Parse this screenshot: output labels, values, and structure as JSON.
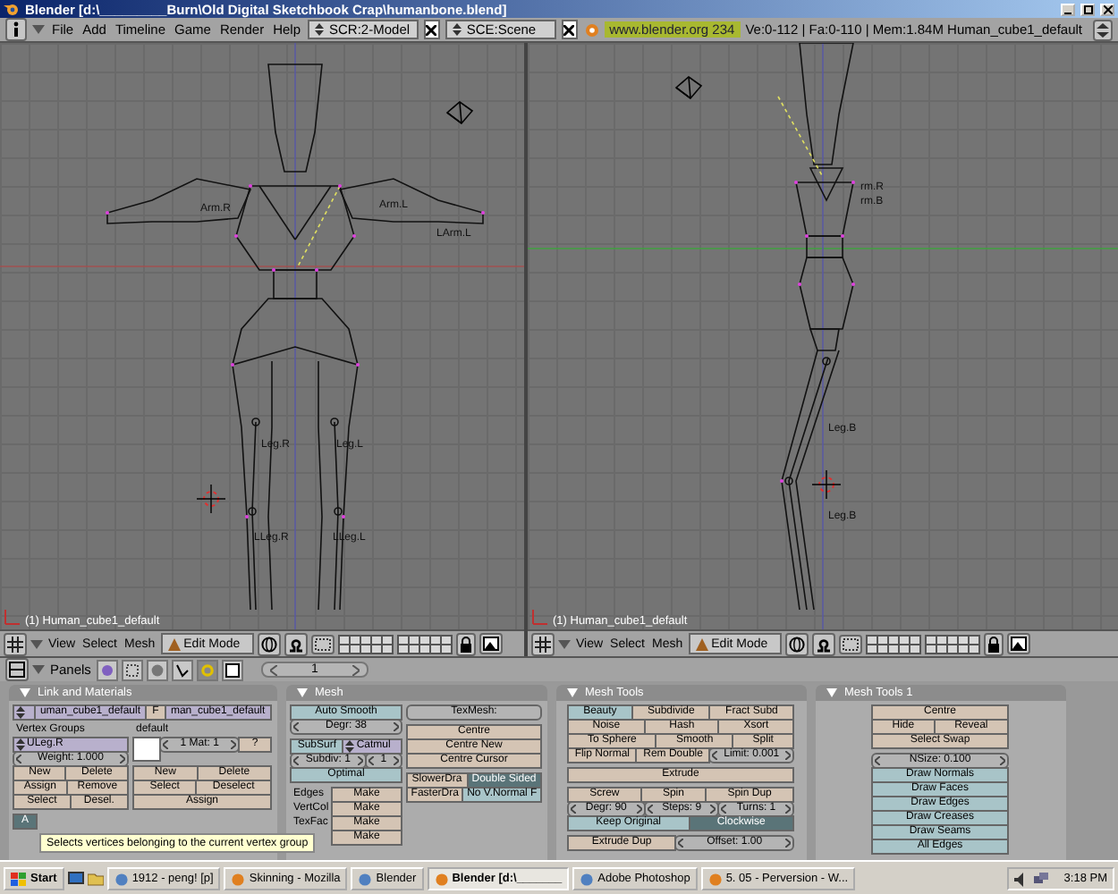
{
  "title_bar": {
    "title": "Blender [d:\\_________Burn\\Old Digital Sketchbook Crap\\humanbone.blend]"
  },
  "menu_bar": {
    "menus": [
      "File",
      "Add",
      "Timeline",
      "Game",
      "Render",
      "Help"
    ],
    "screen": "SCR:2-Model",
    "scene": "SCE:Scene",
    "website": "www.blender.org 234",
    "stats": "Ve:0-112 | Fa:0-110 | Mem:1.84M Human_cube1_default"
  },
  "viewports": [
    {
      "kind": "front",
      "bone_labels": [
        "Arm.R",
        "Arm.L",
        "LArm.L",
        "Leg.R",
        "Leg.L",
        "LLeg.R",
        "LLeg.L"
      ],
      "object_label": "(1) Human_cube1_default",
      "header": {
        "menus": [
          "View",
          "Select",
          "Mesh"
        ],
        "mode": "Edit Mode"
      }
    },
    {
      "kind": "side",
      "bone_labels": [
        "rm.R",
        "rm.B",
        "Leg.B",
        "Leg.B"
      ],
      "object_label": "(1) Human_cube1_default",
      "header": {
        "menus": [
          "View",
          "Select",
          "Mesh"
        ],
        "mode": "Edit Mode"
      }
    }
  ],
  "buttons_header": {
    "label": "Panels",
    "frame": "1"
  },
  "panels": [
    {
      "title": "Link and Materials",
      "top": [
        [
          {
            "kind": "menu"
          },
          {
            "kind": "text",
            "label": "uman_cube1_default"
          },
          {
            "kind": "button",
            "label": "F"
          },
          {
            "kind": "text",
            "label": "man_cube1_default"
          }
        ]
      ],
      "columns": [
        {
          "groups": [
            [
              [
                {
                  "kind": "label",
                  "label": "Vertex Groups"
                }
              ],
              [
                {
                  "kind": "menu",
                  "label": "ULeg.R"
                }
              ],
              [
                {
                  "kind": "number",
                  "label": "Weight: 1.000"
                }
              ],
              [
                {
                  "kind": "button",
                  "label": "New"
                },
                {
                  "kind": "button",
                  "label": "Delete"
                }
              ],
              [
                {
                  "kind": "button",
                  "label": "Assign"
                },
                {
                  "kind": "button",
                  "label": "Remove"
                }
              ],
              [
                {
                  "kind": "button",
                  "label": "Select"
                },
                {
                  "kind": "button",
                  "label": "Desel."
                }
              ]
            ],
            [
              [
                {
                  "kind": "toggle",
                  "label": "A",
                  "on": true
                }
              ]
            ]
          ]
        },
        {
          "groups": [
            [
              [
                {
                  "kind": "label",
                  "label": "default"
                }
              ],
              [
                {
                  "kind": "swatch"
                },
                {
                  "kind": "number",
                  "label": "1 Mat: 1"
                },
                {
                  "kind": "button",
                  "label": "?"
                }
              ]
            ],
            [
              [
                {
                  "kind": "button",
                  "label": "New"
                },
                {
                  "kind": "button",
                  "label": "Delete"
                }
              ],
              [
                {
                  "kind": "button",
                  "label": "Select"
                },
                {
                  "kind": "button",
                  "label": "Deselect"
                }
              ],
              [
                {
                  "kind": "button",
                  "label": "Assign"
                }
              ]
            ]
          ]
        }
      ]
    },
    {
      "title": "Mesh",
      "columns": [
        {
          "groups": [
            [
              [
                {
                  "kind": "toggle",
                  "label": "Auto Smooth",
                  "on": false
                }
              ],
              [
                {
                  "kind": "number",
                  "label": "Degr: 38"
                }
              ]
            ],
            [
              [
                {
                  "kind": "toggle",
                  "label": "SubSurf",
                  "on": false
                },
                {
                  "kind": "menu",
                  "label": "Catmul"
                }
              ],
              [
                {
                  "kind": "number",
                  "label": "Subdiv: 1"
                },
                {
                  "kind": "number",
                  "label": "1"
                }
              ],
              [
                {
                  "kind": "toggle",
                  "label": "Optimal",
                  "on": false
                }
              ]
            ],
            [
              [
                {
                  "kind": "label",
                  "label": "Edges"
                },
                {
                  "kind": "button",
                  "label": "Make"
                }
              ],
              [
                {
                  "kind": "label",
                  "label": "VertCol"
                },
                {
                  "kind": "button",
                  "label": "Make"
                }
              ],
              [
                {
                  "kind": "label",
                  "label": "TexFac"
                },
                {
                  "kind": "button",
                  "label": "Make"
                }
              ],
              [
                {
                  "kind": "label"
                },
                {
                  "kind": "button",
                  "label": "Make"
                }
              ]
            ]
          ]
        },
        {
          "groups": [
            [
              [
                {
                  "kind": "text",
                  "label": "TexMesh:"
                }
              ]
            ],
            [
              [
                {
                  "kind": "button",
                  "label": "Centre"
                }
              ],
              [
                {
                  "kind": "button",
                  "label": "Centre New"
                }
              ],
              [
                {
                  "kind": "button",
                  "label": "Centre Cursor"
                }
              ]
            ],
            [
              [
                {
                  "kind": "button",
                  "label": "SlowerDra"
                },
                {
                  "kind": "toggle",
                  "label": "Double Sided",
                  "on": true
                }
              ],
              [
                {
                  "kind": "button",
                  "label": "FasterDra"
                },
                {
                  "kind": "toggle",
                  "label": "No V.Normal F",
                  "on": false
                }
              ]
            ]
          ]
        }
      ]
    },
    {
      "title": "Mesh Tools",
      "columns": [
        {
          "groups": [
            [
              [
                {
                  "kind": "toggle",
                  "label": "Beauty",
                  "on": false
                },
                {
                  "kind": "button",
                  "label": "Subdivide"
                },
                {
                  "kind": "button",
                  "label": "Fract Subd"
                }
              ],
              [
                {
                  "kind": "button",
                  "label": "Noise"
                },
                {
                  "kind": "button",
                  "label": "Hash"
                },
                {
                  "kind": "button",
                  "label": "Xsort"
                }
              ],
              [
                {
                  "kind": "button",
                  "label": "To Sphere"
                },
                {
                  "kind": "button",
                  "label": "Smooth"
                },
                {
                  "kind": "button",
                  "label": "Split"
                }
              ],
              [
                {
                  "kind": "button",
                  "label": "Flip Normal"
                },
                {
                  "kind": "button",
                  "label": "Rem Double"
                },
                {
                  "kind": "number",
                  "label": "Limit: 0.001"
                }
              ]
            ],
            [
              [
                {
                  "kind": "button",
                  "label": "Extrude"
                }
              ]
            ],
            [
              [
                {
                  "kind": "button",
                  "label": "Screw"
                },
                {
                  "kind": "button",
                  "label": "Spin"
                },
                {
                  "kind": "button",
                  "label": "Spin Dup"
                }
              ],
              [
                {
                  "kind": "number",
                  "label": "Degr: 90"
                },
                {
                  "kind": "number",
                  "label": "Steps: 9"
                },
                {
                  "kind": "number",
                  "label": "Turns: 1"
                }
              ],
              [
                {
                  "kind": "toggle",
                  "label": "Keep Original",
                  "on": false
                },
                {
                  "kind": "toggle",
                  "label": "Clockwise",
                  "on": true
                }
              ]
            ],
            [
              [
                {
                  "kind": "button",
                  "label": "Extrude Dup"
                },
                {
                  "kind": "number",
                  "label": "Offset: 1.00"
                }
              ]
            ]
          ]
        }
      ]
    },
    {
      "title": "Mesh Tools 1",
      "columns": [
        {
          "groups": [
            [
              [
                {
                  "kind": "button",
                  "label": "Centre"
                }
              ],
              [
                {
                  "kind": "button",
                  "label": "Hide"
                },
                {
                  "kind": "button",
                  "label": "Reveal"
                }
              ],
              [
                {
                  "kind": "button",
                  "label": "Select Swap"
                }
              ]
            ],
            [
              [
                {
                  "kind": "number",
                  "label": "NSize: 0.100"
                }
              ],
              [
                {
                  "kind": "toggle",
                  "label": "Draw Normals",
                  "on": false
                }
              ],
              [
                {
                  "kind": "toggle",
                  "label": "Draw Faces",
                  "on": false
                }
              ],
              [
                {
                  "kind": "toggle",
                  "label": "Draw Edges",
                  "on": false
                }
              ],
              [
                {
                  "kind": "toggle",
                  "label": "Draw Creases",
                  "on": false
                }
              ],
              [
                {
                  "kind": "toggle",
                  "label": "Draw Seams",
                  "on": false
                }
              ],
              [
                {
                  "kind": "toggle",
                  "label": "All Edges",
                  "on": false
                }
              ]
            ]
          ]
        }
      ]
    }
  ],
  "tooltip": "Selects vertices belonging to the current vertex group",
  "taskbar": {
    "start": "Start",
    "tasks": [
      {
        "label": "1912 - peng! [p]",
        "selected": false
      },
      {
        "label": "Skinning - Mozilla",
        "selected": false
      },
      {
        "label": "Blender",
        "selected": false
      },
      {
        "label": "Blender [d:\\_______",
        "selected": true
      },
      {
        "label": "Adobe Photoshop",
        "selected": false
      },
      {
        "label": "5. 05 - Perversion - W...",
        "selected": false
      }
    ],
    "clock": "3:18 PM"
  }
}
